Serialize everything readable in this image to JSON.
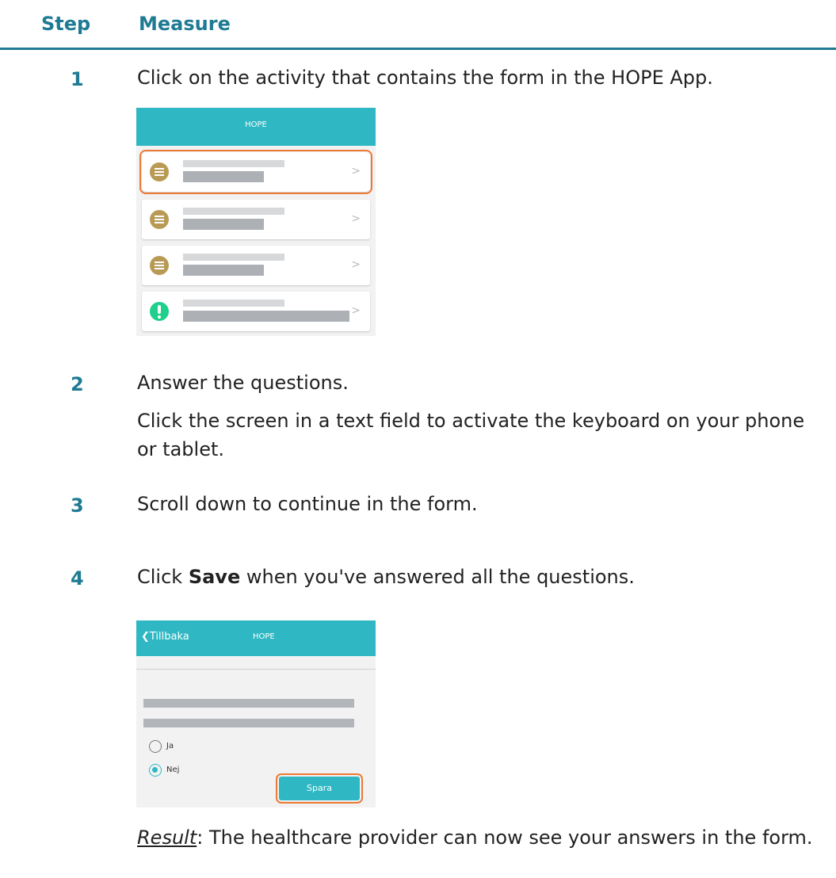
{
  "header": {
    "step": "Step",
    "measure": "Measure"
  },
  "steps": [
    {
      "num": "1",
      "text": "Click on the activity that contains the form in the HOPE App."
    },
    {
      "num": "2",
      "text": "Answer the questions.",
      "text2": "Click the screen in a text field to activate the keyboard on your phone or tablet."
    },
    {
      "num": "3",
      "text": "Scroll down to continue in the form."
    },
    {
      "num": "4",
      "text_pre": "Click ",
      "text_bold": "Save",
      "text_post": " when you've answered all the questions."
    }
  ],
  "shot1": {
    "title": "HOPE",
    "chevron": ">"
  },
  "shot2": {
    "back": "❮Tillbaka",
    "title": "HOPE",
    "option_yes": "Ja",
    "option_no": "Nej",
    "save": "Spara"
  },
  "result": {
    "label": "Result",
    "text": ": The healthcare provider can now see your answers in the form."
  },
  "colors": {
    "accent": "#1f7a94",
    "app_teal": "#2fb8c3",
    "highlight": "#ec7a34",
    "list_icon": "#b89a54",
    "alert_icon": "#1fd08b"
  }
}
